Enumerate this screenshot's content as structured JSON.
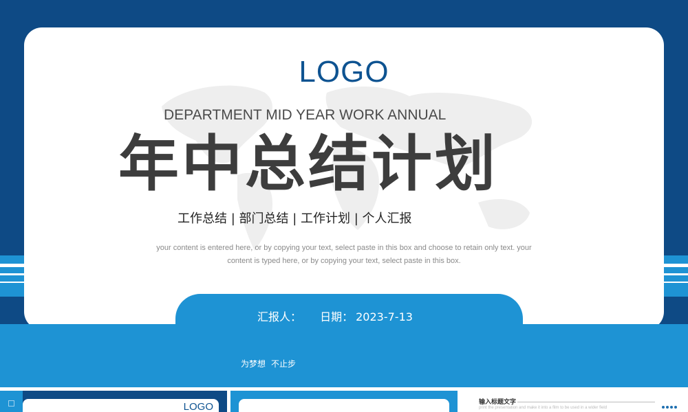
{
  "slide": {
    "logo": "LOGO",
    "subtitle_en": "DEPARTMENT MID YEAR WORK ANNUAL",
    "title": "年中总结计划",
    "tags": "工作总结 | 部门总结 | 工作计划 | 个人汇报",
    "description_line1": "your content is entered here, or by copying your text, select paste in this box and choose to retain only text. your",
    "description_line2": "content is typed here, or by copying your text, select paste in this box.",
    "reporter_label": "汇报人：",
    "date_label": "日期：",
    "date_value": "2023-7-13",
    "slogan_part1": "为梦想",
    "slogan_part2": "不止步"
  },
  "thumbnails": {
    "thumb1_logo": "LOGO",
    "thumb3_title": "输入标题文字",
    "thumb3_subtitle": "print the presentation and make it into a film to be used in a wider field"
  },
  "colors": {
    "navy": "#0e4a85",
    "blue": "#1e93d4",
    "logo_blue": "#0e5391",
    "title_gray": "#3d3d3d"
  }
}
